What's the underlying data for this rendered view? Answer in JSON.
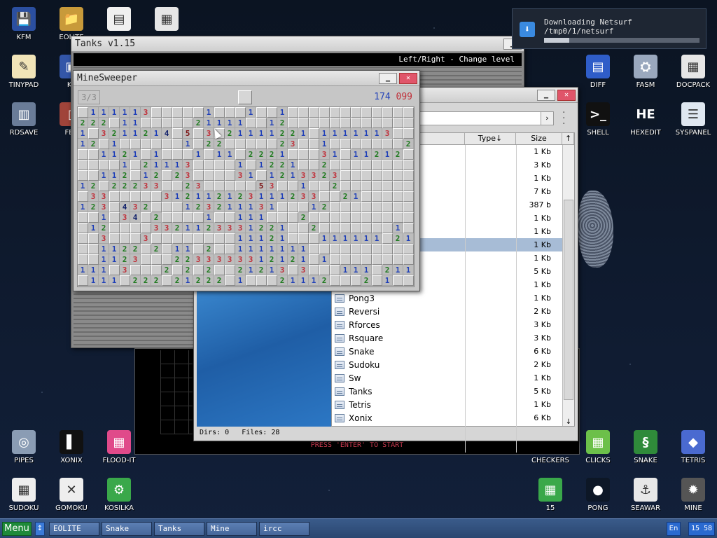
{
  "desktop_left": [
    {
      "label": "KFM",
      "icon": "floppy-icon",
      "glyph": "💾",
      "bg": "#2b4fa0"
    },
    {
      "label": "EOLITE",
      "icon": "folder-icon",
      "glyph": "📁",
      "bg": "#c89a3a"
    },
    {
      "label": "",
      "icon": "notebook-icon",
      "glyph": "▤",
      "bg": "#f0f0f0"
    },
    {
      "label": "",
      "icon": "calculator-icon",
      "glyph": "▦",
      "bg": "#e6e6e6"
    },
    {
      "label": "TINYPAD",
      "icon": "notepad-icon",
      "glyph": "✎",
      "bg": "#f1e4b8"
    },
    {
      "label": "KF",
      "icon": "kfm2-icon",
      "glyph": "▣",
      "bg": "#3356a8"
    },
    {
      "label": "RDSAVE",
      "icon": "rdsave-icon",
      "glyph": "▥",
      "bg": "#6a7c98"
    },
    {
      "label": "FB2",
      "icon": "book-icon",
      "glyph": "▯",
      "bg": "#a0443a"
    }
  ],
  "desktop_right": [
    {
      "label": "DIFF",
      "icon": "diff-icon",
      "glyph": "▤",
      "bg": "#2f5dc8"
    },
    {
      "label": "FASM",
      "icon": "fasm-icon",
      "glyph": "⛭",
      "bg": "#9aa8be"
    },
    {
      "label": "DOCPACK",
      "icon": "docpack-icon",
      "glyph": "▦",
      "bg": "#e6e6e6"
    },
    {
      "label": "SHELL",
      "icon": "shell-icon",
      "glyph": ">_",
      "bg": "#111"
    },
    {
      "label": "HEXEDIT",
      "icon": "hexedit-icon",
      "glyph": "HE",
      "bg": "#0d1726"
    },
    {
      "label": "SYSPANEL",
      "icon": "syspanel-icon",
      "glyph": "☰",
      "bg": "#dfe7f1"
    }
  ],
  "desktop_bottom": [
    {
      "label": "PIPES",
      "icon": "pipes-icon",
      "glyph": "◎",
      "bg": "#8a9cb4"
    },
    {
      "label": "XONIX",
      "icon": "xonix-icon",
      "glyph": "▌",
      "bg": "#111"
    },
    {
      "label": "FLOOD-IT",
      "icon": "flood-it-icon",
      "glyph": "▦",
      "bg": "#e04a8a"
    },
    {
      "label": "CHECKERS",
      "icon": "checkers-icon",
      "glyph": "",
      "bg": "transparent"
    },
    {
      "label": "CLICKS",
      "icon": "clicks-icon",
      "glyph": "▦",
      "bg": "#6cc04a"
    },
    {
      "label": "SNAKE",
      "icon": "snake-icon",
      "glyph": "§",
      "bg": "#2f8a3a"
    },
    {
      "label": "TETRIS",
      "icon": "tetris-icon",
      "glyph": "◆",
      "bg": "#4a6ad0"
    },
    {
      "label": "SUDOKU",
      "icon": "sudoku-icon",
      "glyph": "▦",
      "bg": "#eee"
    },
    {
      "label": "GOMOKU",
      "icon": "gomoku-icon",
      "glyph": "✕",
      "bg": "#eee"
    },
    {
      "label": "KOSILKA",
      "icon": "lawnmower-icon",
      "glyph": "⚙",
      "bg": "#3aa84a"
    },
    {
      "label": "15",
      "icon": "fifteen-icon",
      "glyph": "▦",
      "bg": "#3aa84a"
    },
    {
      "label": "PONG",
      "icon": "pong-icon",
      "glyph": "●",
      "bg": "#0d1726"
    },
    {
      "label": "SEAWAR",
      "icon": "seawar-icon",
      "glyph": "⚓",
      "bg": "#e8e8e8"
    },
    {
      "label": "MINE",
      "icon": "mine-icon",
      "glyph": "✹",
      "bg": "#555"
    }
  ],
  "notification": {
    "title": "Downloading Netsurf",
    "path": "/tmp0/1/netsurf",
    "progress": 0.16
  },
  "tanks": {
    "title": "Tanks v1.15",
    "hint": "Left/Right - Change level",
    "start": "PRESS 'ENTER' TO START"
  },
  "fm": {
    "headers": {
      "type": "Type↓",
      "size": "Size"
    },
    "rows": [
      {
        "name": "",
        "size": "1 Kb"
      },
      {
        "name": "",
        "size": "3 Kb"
      },
      {
        "name": "",
        "size": "1 Kb"
      },
      {
        "name": "",
        "size": "7 Kb"
      },
      {
        "name": "",
        "size": "387 b"
      },
      {
        "name": "",
        "size": "1 Kb"
      },
      {
        "name": "",
        "size": "1 Kb"
      },
      {
        "name": "",
        "size": "1 Kb"
      },
      {
        "name": "",
        "size": "1 Kb"
      },
      {
        "name": "",
        "size": "5 Kb"
      },
      {
        "name": "",
        "size": "1 Kb"
      },
      {
        "name": "Pong3",
        "size": "1 Kb"
      },
      {
        "name": "Reversi",
        "size": "2 Kb"
      },
      {
        "name": "Rforces",
        "size": "3 Kb"
      },
      {
        "name": "Rsquare",
        "size": "3 Kb"
      },
      {
        "name": "Snake",
        "size": "6 Kb"
      },
      {
        "name": "Sudoku",
        "size": "2 Kb"
      },
      {
        "name": "Sw",
        "size": "1 Kb"
      },
      {
        "name": "Tanks",
        "size": "5 Kb"
      },
      {
        "name": "Tetris",
        "size": "1 Kb"
      },
      {
        "name": "Xonix",
        "size": "6 Kb"
      }
    ],
    "selected_row": 7,
    "status": "Dirs: 0   Files: 28"
  },
  "minesweeper": {
    "title": "MineSweeper",
    "level": "3/3",
    "mines_left": "174",
    "time": "099",
    "grid": [
      "#111113#####1###1##1############",
      "222#11#####21111##12############",
      "1#3211214#5#3#21111221#1111113##",
      "12#1######1#22#####23##1#######2",
      "##1121#1###1#11#2221###31#11212#",
      "####1#21113####1#1221##2########",
      "##112#12#23####31#1213323#######",
      "12#22233##23#####53##1##2#######",
      "#33#####312112123111233##21#####",
      "123#432###123211131###12########",
      "##1#34#2####1##111###2##########",
      "#12####3321123331221##2#######1#",
      "##3###3########11121###111111#21",
      "##1122#2#11#2##1111111##########",
      "##1123###2233333312121#1########",
      "111#3###2#2#2##21213#3###111#211",
      "#111#222#21222#1###21112###2#1##"
    ]
  },
  "taskbar": {
    "menu": "Menu",
    "tasks": [
      "EOLITE",
      "Snake",
      "Tanks",
      "Mine",
      "ircc"
    ],
    "lang": "En",
    "clock": "15 58"
  },
  "colors": {
    "n1": "#1f3fb8",
    "n2": "#1e7a1e",
    "n3": "#c0303a",
    "n4": "#10206a",
    "n5": "#7a1010",
    "selected": "#a7bcd6"
  }
}
